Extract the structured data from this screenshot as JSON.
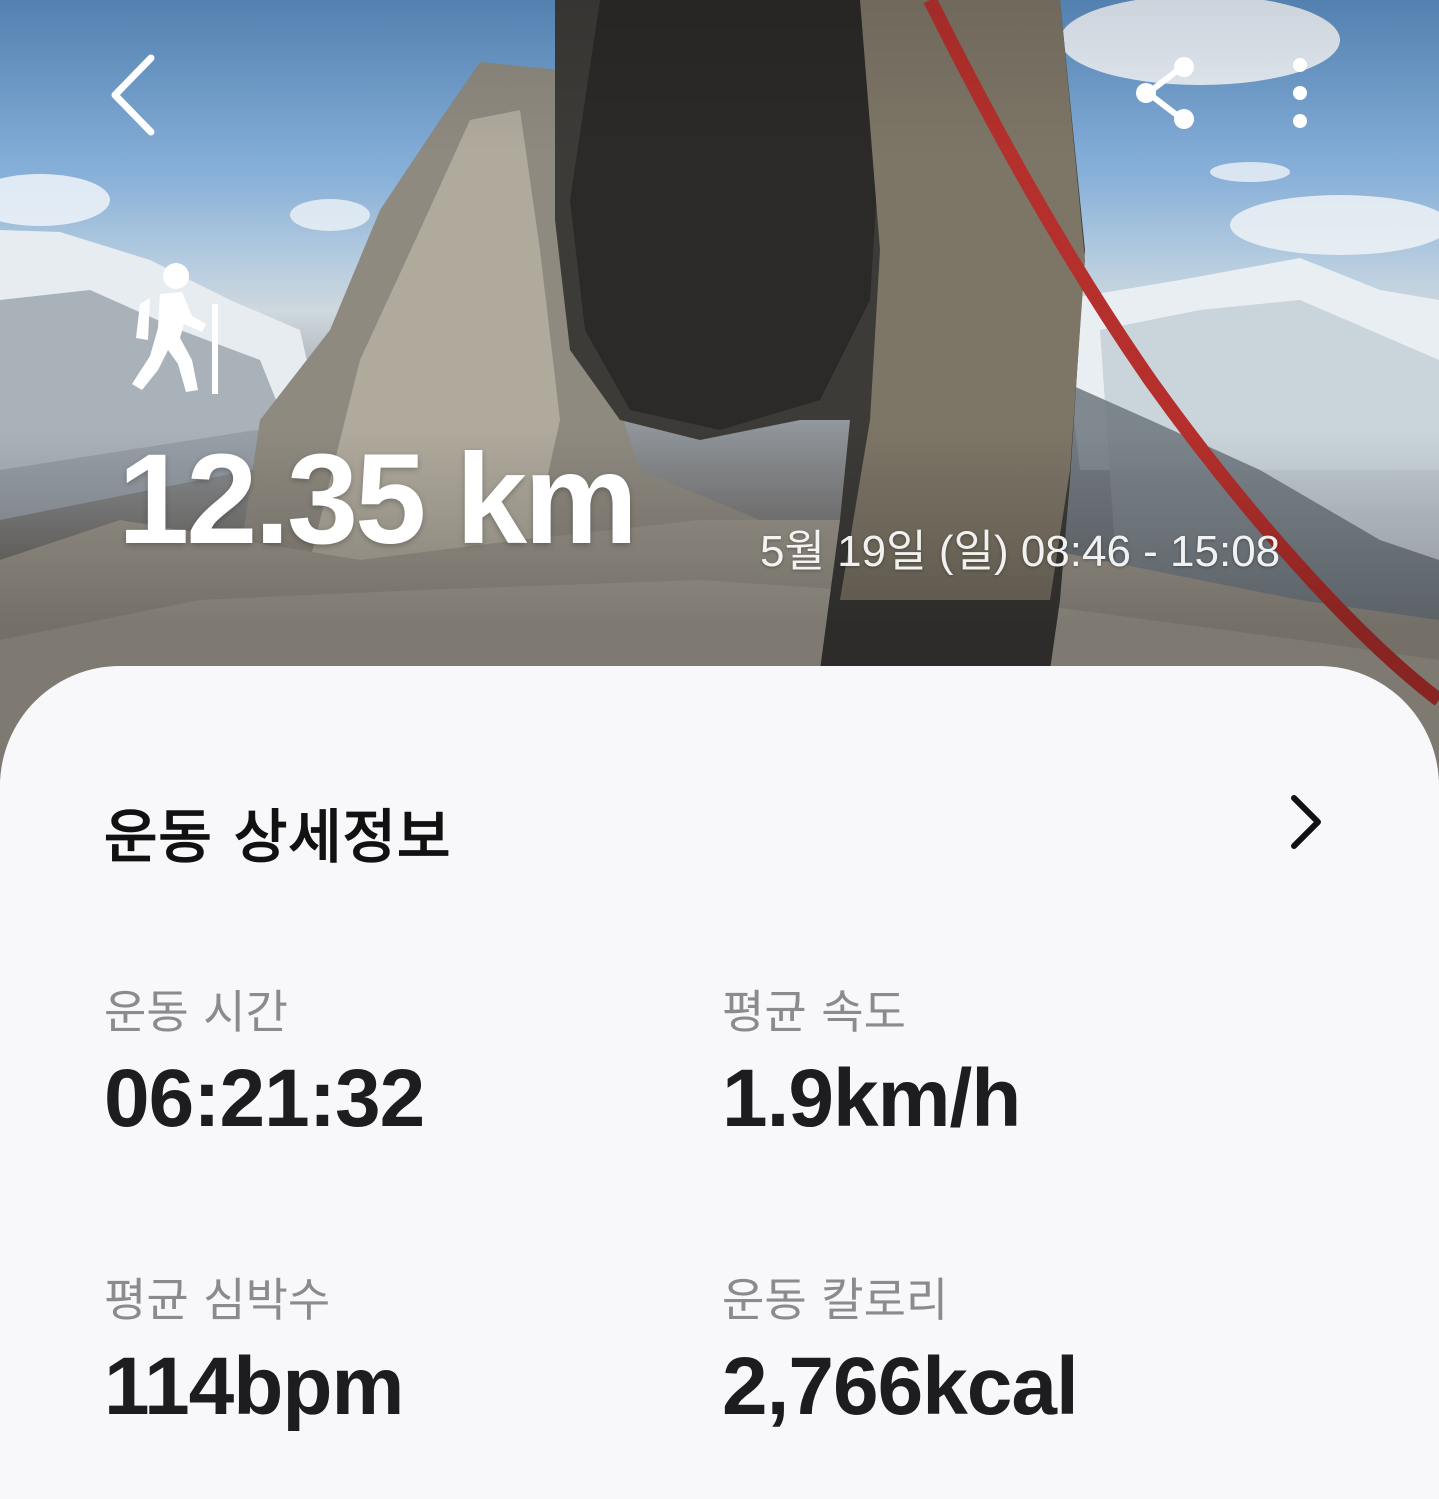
{
  "hero": {
    "distance": "12.35 km",
    "datetime": "5월 19일 (일) 08:46 - 15:08",
    "workout_type_icon": "hiking-icon",
    "toolbar_icons": [
      "back-arrow-icon",
      "share-icon",
      "more-vertical-icon"
    ]
  },
  "details": {
    "title": "운동 상세정보",
    "chevron_icon": "chevron-right-icon",
    "stats": [
      {
        "label": "운동 시간",
        "value": "06:21:32"
      },
      {
        "label": "평균 속도",
        "value": "1.9km/h"
      },
      {
        "label": "평균 심박수",
        "value": "114bpm"
      },
      {
        "label": "운동 칼로리",
        "value": "2,766kcal"
      }
    ]
  },
  "colors": {
    "card_background": "#f8f8fb",
    "title_text": "#111111",
    "label_text": "#8a8a8f",
    "value_text": "#1d1d1f",
    "hero_text": "#ffffff"
  }
}
